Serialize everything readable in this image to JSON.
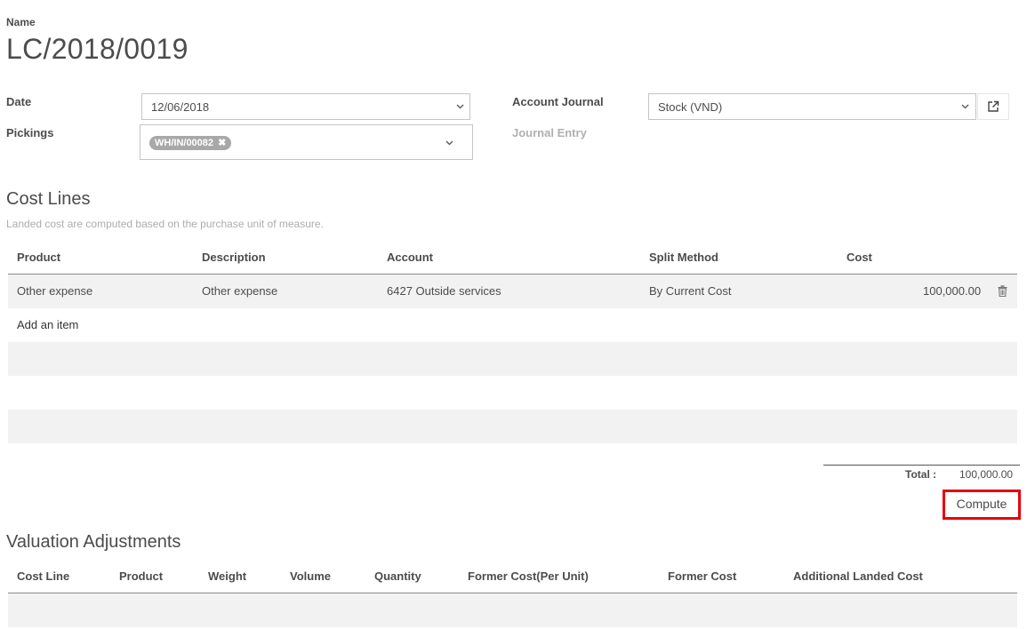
{
  "form": {
    "name_label": "Name",
    "name_value": "LC/2018/0019",
    "date_label": "Date",
    "date_value": "12/06/2018",
    "pickings_label": "Pickings",
    "pickings_tag": "WH/IN/00082",
    "account_journal_label": "Account Journal",
    "account_journal_value": "Stock (VND)",
    "journal_entry_label": "Journal Entry"
  },
  "cost_lines": {
    "title": "Cost Lines",
    "help": "Landed cost are computed based on the purchase unit of measure.",
    "columns": [
      "Product",
      "Description",
      "Account",
      "Split Method",
      "Cost"
    ],
    "rows": [
      {
        "product": "Other expense",
        "description": "Other expense",
        "account": "6427 Outside services",
        "split_method": "By Current Cost",
        "cost": "100,000.00"
      }
    ],
    "add_item": "Add an item",
    "total_label": "Total :",
    "total_value": "100,000.00"
  },
  "compute_label": "Compute",
  "valuation": {
    "title": "Valuation Adjustments",
    "columns": [
      "Cost Line",
      "Product",
      "Weight",
      "Volume",
      "Quantity",
      "Former Cost(Per Unit)",
      "Former Cost",
      "Additional Landed Cost"
    ]
  },
  "colors": {
    "highlight": "#e8000b",
    "tag_bg": "#a8a8a8",
    "row_bg": "#f2f2f2"
  }
}
